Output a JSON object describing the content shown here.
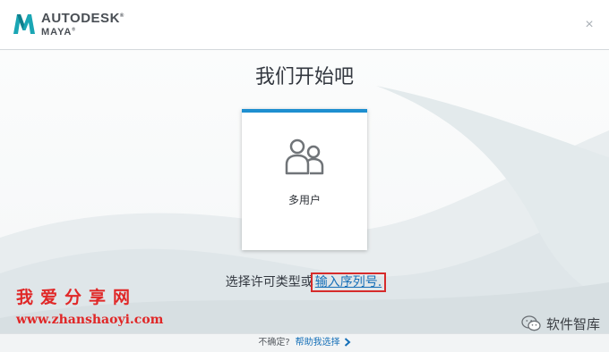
{
  "header": {
    "brand_line1": "AUTODESK",
    "brand_line1_mark": "®",
    "brand_line2": "MAYA",
    "brand_line2_mark": "®",
    "close_label": "×",
    "logo_icon": "maya-m-logo-icon",
    "logo_color": "#1aa6b4"
  },
  "main": {
    "title": "我们开始吧",
    "card": {
      "label": "多用户",
      "icon": "multi-user-icon",
      "accent_color": "#1e8fd0"
    },
    "choice_prefix": "选择许可类型或",
    "serial_link": "输入序列号."
  },
  "watermark": {
    "title": "我爱分享网",
    "url": "www.zhanshaoyi.com",
    "wechat_label": "软件智库",
    "color": "#e02727"
  },
  "footer": {
    "question": "不确定?",
    "help_link": "帮助我选择",
    "link_color": "#1670b8"
  }
}
